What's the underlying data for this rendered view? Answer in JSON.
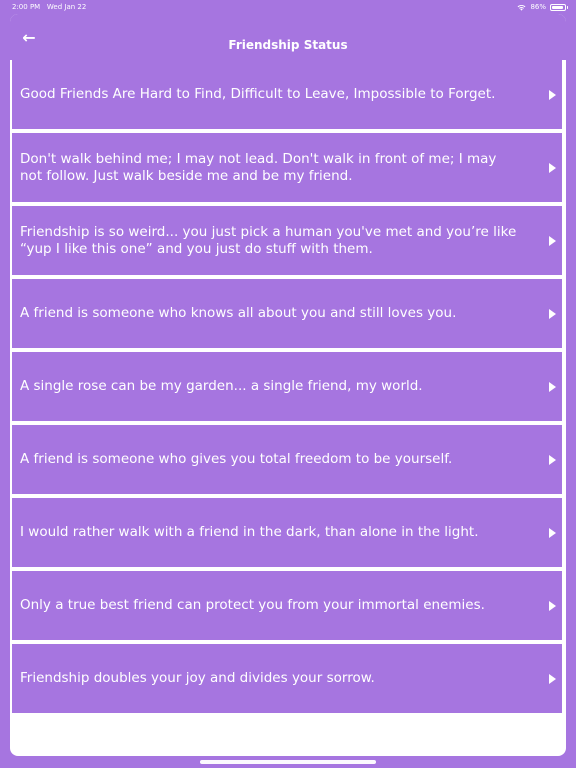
{
  "status": {
    "time": "2:00 PM",
    "date": "Wed Jan 22",
    "battery": "86%",
    "wifi_icon": "wifi-icon",
    "battery_icon": "battery-icon"
  },
  "header": {
    "title": "Friendship Status",
    "back_icon": "back-arrow-icon",
    "back_glyph": "←",
    "color": "#a675e0"
  },
  "items": [
    {
      "text": "Good Friends Are Hard to Find, Difficult to Leave, Impossible to Forget."
    },
    {
      "text": "Don't walk behind me; I may not lead. Don't walk in front of me; I may not follow. Just walk beside me and be my friend."
    },
    {
      "text": "Friendship is so weird... you just pick a human you've met and you’re like “yup I like this one” and you just do stuff with them."
    },
    {
      "text": "A friend is someone who knows all about you and still loves you."
    },
    {
      "text": "A single rose can be my garden... a single friend, my world."
    },
    {
      "text": "A friend is someone who gives you total freedom to be yourself."
    },
    {
      "text": " I would rather walk with a friend in the dark, than alone in the light."
    },
    {
      "text": "Only a true best friend can protect you from your immortal enemies."
    },
    {
      "text": "Friendship doubles your joy and divides your sorrow."
    }
  ]
}
